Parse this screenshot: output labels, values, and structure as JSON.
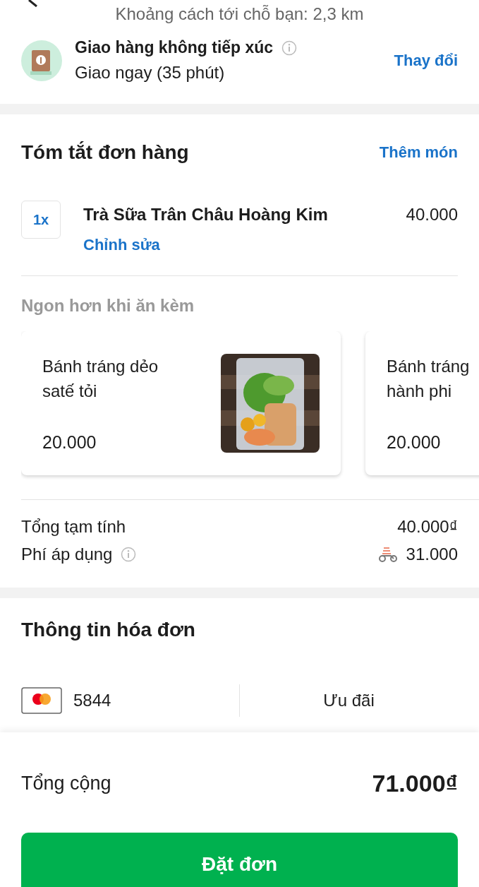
{
  "header": {
    "distance": "Khoảng cách tới chỗ bạn: 2,3 km"
  },
  "delivery": {
    "title": "Giao hàng không tiếp xúc",
    "subtitle": "Giao ngay (35 phút)",
    "action": "Thay đổi"
  },
  "summary": {
    "title": "Tóm tắt đơn hàng",
    "action": "Thêm món",
    "items": [
      {
        "quantity": "1x",
        "name": "Trà Sữa Trân Châu Hoàng Kim",
        "price": "40.000",
        "edit": "Chỉnh sửa"
      }
    ],
    "suggestions_title": "Ngon hơn khi ăn kèm",
    "suggestions": [
      {
        "name": "Bánh tráng dẻo satế tỏi",
        "price": "20.000",
        "kind": "picture"
      },
      {
        "name": "Bánh tráng hành phi",
        "price": "20.000"
      }
    ],
    "totals": [
      {
        "label": "Tổng tạm tính",
        "value": "40.000₫",
        "kind": "plain"
      },
      {
        "label": "Phí áp dụng",
        "value": "31.000",
        "kind": "fee"
      }
    ]
  },
  "billing": {
    "title": "Thông tin hóa đơn",
    "card": "5844",
    "promo": "Ưu đãi"
  },
  "footer": {
    "label": "Tổng cộng",
    "total": "71.000₫",
    "button": "Đặt đơn"
  }
}
